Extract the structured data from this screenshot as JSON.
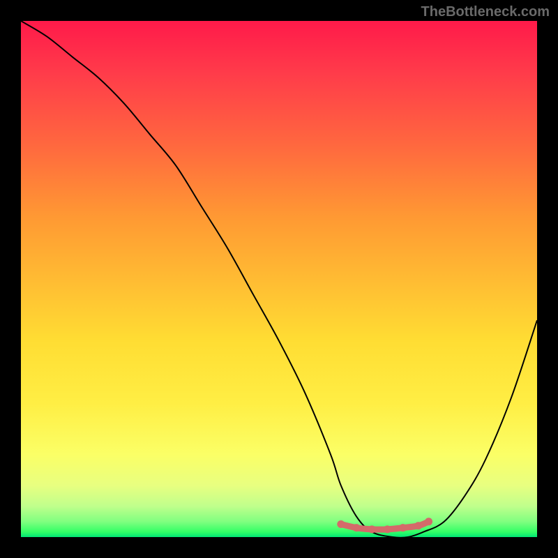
{
  "watermark": "TheBottleneck.com",
  "chart_data": {
    "type": "line",
    "title": "",
    "xlabel": "",
    "ylabel": "",
    "xlim": [
      0,
      100
    ],
    "ylim": [
      0,
      100
    ],
    "series": [
      {
        "name": "bottleneck-curve",
        "x": [
          0,
          5,
          10,
          15,
          20,
          25,
          30,
          35,
          40,
          45,
          50,
          55,
          60,
          62,
          65,
          68,
          72,
          75,
          78,
          82,
          86,
          90,
          95,
          100
        ],
        "y": [
          100,
          97,
          93,
          89,
          84,
          78,
          72,
          64,
          56,
          47,
          38,
          28,
          16,
          10,
          4,
          1,
          0,
          0,
          1,
          3,
          8,
          15,
          27,
          42
        ]
      },
      {
        "name": "optimal-range-marker",
        "x": [
          62,
          65,
          68,
          71,
          74,
          77,
          79
        ],
        "y": [
          2.5,
          1.8,
          1.5,
          1.5,
          1.8,
          2.2,
          3.0
        ]
      }
    ],
    "gradient_stops": [
      {
        "pos": 0,
        "color": "#ff1a4a"
      },
      {
        "pos": 50,
        "color": "#ffbb33"
      },
      {
        "pos": 85,
        "color": "#fbff66"
      },
      {
        "pos": 100,
        "color": "#00e676"
      }
    ]
  }
}
